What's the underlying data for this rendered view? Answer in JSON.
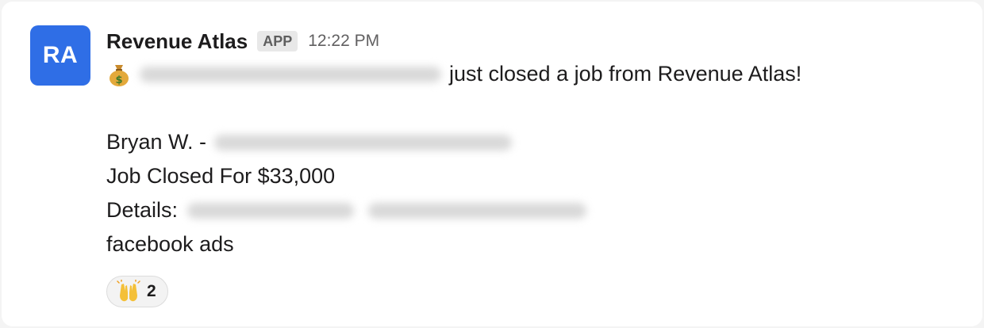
{
  "avatar": {
    "initials": "RA",
    "color": "#2f6ee6"
  },
  "message": {
    "sender": "Revenue Atlas",
    "badge": "APP",
    "time": "12:22 PM",
    "line1_text": "just closed a job from Revenue Atlas!",
    "client_prefix": "Bryan W. -",
    "job_line": "Job Closed For $33,000",
    "details_label": "Details:",
    "service": "facebook ads"
  },
  "reaction": {
    "icon": "raised-hands-icon",
    "count": "2"
  }
}
